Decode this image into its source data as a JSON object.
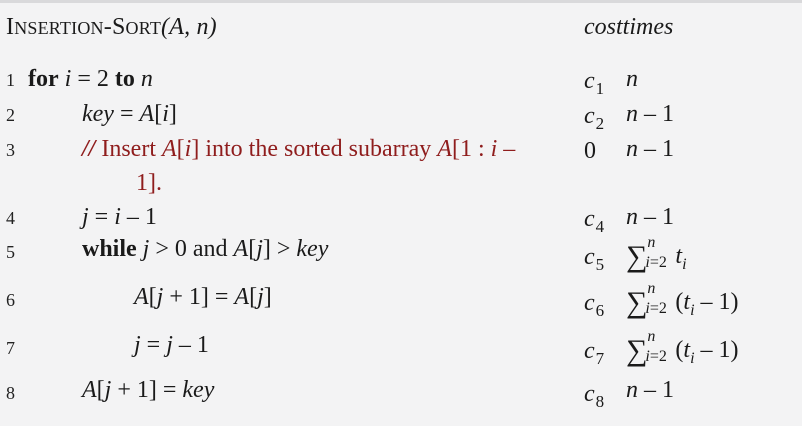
{
  "header": {
    "proc_i": "I",
    "proc_nsertion": "NSERTION",
    "proc_dash": "-",
    "proc_s": "S",
    "proc_ort": "ORT",
    "args": "(A, n)",
    "columns_label": "costtimes"
  },
  "lines": [
    {
      "num": "1",
      "kw1": "for",
      "sp1": " ",
      "v1": "i",
      "t1": " = 2 ",
      "kw2": "to",
      "sp2": " ",
      "v2": "n",
      "cost_c": "c",
      "cost_sub": "1",
      "times": "n"
    },
    {
      "num": "2",
      "v1": "key",
      "t1": " = ",
      "v2": "A",
      "t2": "[",
      "v3": "i",
      "t3": "]",
      "cost_c": "c",
      "cost_sub": "2",
      "times_v": "n",
      "times_t": " – 1"
    },
    {
      "num": "3",
      "comment_mark": "//",
      "c_t1": " Insert ",
      "c_v1": "A",
      "c_t2": "[",
      "c_v2": "i",
      "c_t3": "] into the sorted subarray ",
      "c_v3": "A",
      "c_t4": "[1 : ",
      "c_v4": "i",
      "c_t5": " –",
      "c_cont": "1].",
      "cost_zero": "0",
      "times_v": "n",
      "times_t": " – 1"
    },
    {
      "num": "4",
      "v1": "j",
      "t1": " = ",
      "v2": "i",
      "t2": " – 1",
      "cost_c": "c",
      "cost_sub": "4",
      "times_v": "n",
      "times_t": " – 1"
    },
    {
      "num": "5",
      "kw1": "while",
      "sp1": " ",
      "v1": "j",
      "t1": " > 0 and ",
      "v2": "A",
      "t2": "[",
      "v3": "j",
      "t3": "] > ",
      "v4": "key",
      "cost_c": "c",
      "cost_sub": "5",
      "sum": "∑",
      "sum_up": "n",
      "sum_lo_v": "i",
      "sum_lo_t": "=2",
      "sum_body_v": "t",
      "sum_body_sub": "i"
    },
    {
      "num": "6",
      "v1": "A",
      "t1": "[",
      "v2": "j",
      "t2": " + 1] = ",
      "v3": "A",
      "t3": "[",
      "v4": "j",
      "t4": "]",
      "cost_c": "c",
      "cost_sub": "6",
      "sum": "∑",
      "sum_up": "n",
      "sum_lo_v": "i",
      "sum_lo_t": "=2",
      "sum_open": "(",
      "sum_body_v": "t",
      "sum_body_sub": "i",
      "sum_close": " – 1)"
    },
    {
      "num": "7",
      "v1": "j",
      "t1": " = ",
      "v2": "j",
      "t2": " – 1",
      "cost_c": "c",
      "cost_sub": "7",
      "sum": "∑",
      "sum_up": "n",
      "sum_lo_v": "i",
      "sum_lo_t": "=2",
      "sum_open": "(",
      "sum_body_v": "t",
      "sum_body_sub": "i",
      "sum_close": " – 1)"
    },
    {
      "num": "8",
      "v1": "A",
      "t1": "[",
      "v2": "j",
      "t2": " + 1] = ",
      "v3": "key",
      "cost_c": "c",
      "cost_sub": "8",
      "times_v": "n",
      "times_t": " – 1"
    }
  ],
  "colors": {
    "background": "#f3f3f4",
    "comment": "#8f1d1d",
    "text": "#1a1a1a"
  }
}
